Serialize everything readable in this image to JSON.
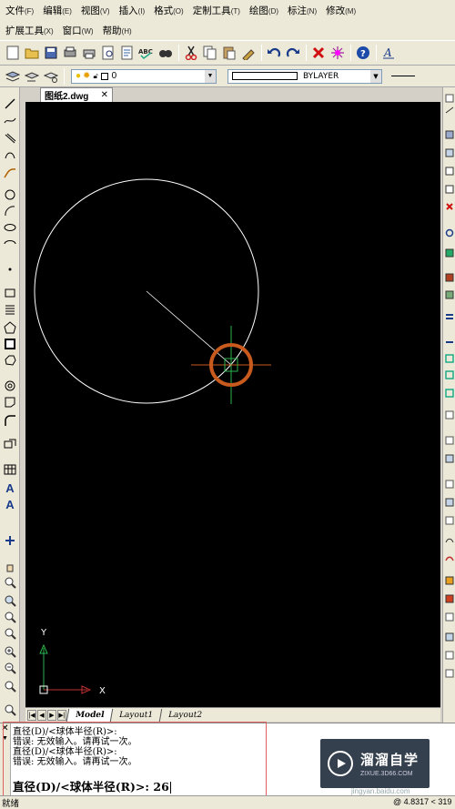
{
  "menu": {
    "row1": [
      {
        "label": "文件",
        "acc": "(F)"
      },
      {
        "label": "编辑",
        "acc": "(E)"
      },
      {
        "label": "视图",
        "acc": "(V)"
      },
      {
        "label": "插入",
        "acc": "(I)"
      },
      {
        "label": "格式",
        "acc": "(O)"
      },
      {
        "label": "定制工具",
        "acc": "(T)"
      },
      {
        "label": "绘图",
        "acc": "(D)"
      },
      {
        "label": "标注",
        "acc": "(N)"
      },
      {
        "label": "修改",
        "acc": "(M)"
      }
    ],
    "row2": [
      {
        "label": "扩展工具",
        "acc": "(X)"
      },
      {
        "label": "窗口",
        "acc": "(W)"
      },
      {
        "label": "帮助",
        "acc": "(H)"
      }
    ]
  },
  "layer": {
    "current": "0"
  },
  "linetype": {
    "value": "BYLAYER"
  },
  "document_tab": {
    "title": "图纸2.dwg",
    "close": "✕"
  },
  "ucs": {
    "y_label": "Y",
    "x_label": "X"
  },
  "layout_tabs": [
    "Model",
    "Layout1",
    "Layout2"
  ],
  "command": {
    "history": [
      "直径(D)/<球体半径(R)>:",
      "错误: 无效输入。请再试一次。",
      "直径(D)/<球体半径(R)>:",
      "错误: 无效输入。请再试一次。"
    ],
    "prompt": "直径(D)/<球体半径(R)>: ",
    "input_value": "26"
  },
  "status": {
    "left_text": "就绪",
    "coords": "@ 4.8317 < 319"
  },
  "watermark": {
    "title": "溜溜自学",
    "sub": "ZIXUE.3D66.COM",
    "url": "jingyan.baidu.com"
  },
  "colors": {
    "canvas_bg": "#000000",
    "circle": "#ffffff",
    "snap_marker": "#c85a1e",
    "crosshair": "#2bb24c",
    "ucs_y": "#2bb24c",
    "ucs_x": "#c03030"
  }
}
